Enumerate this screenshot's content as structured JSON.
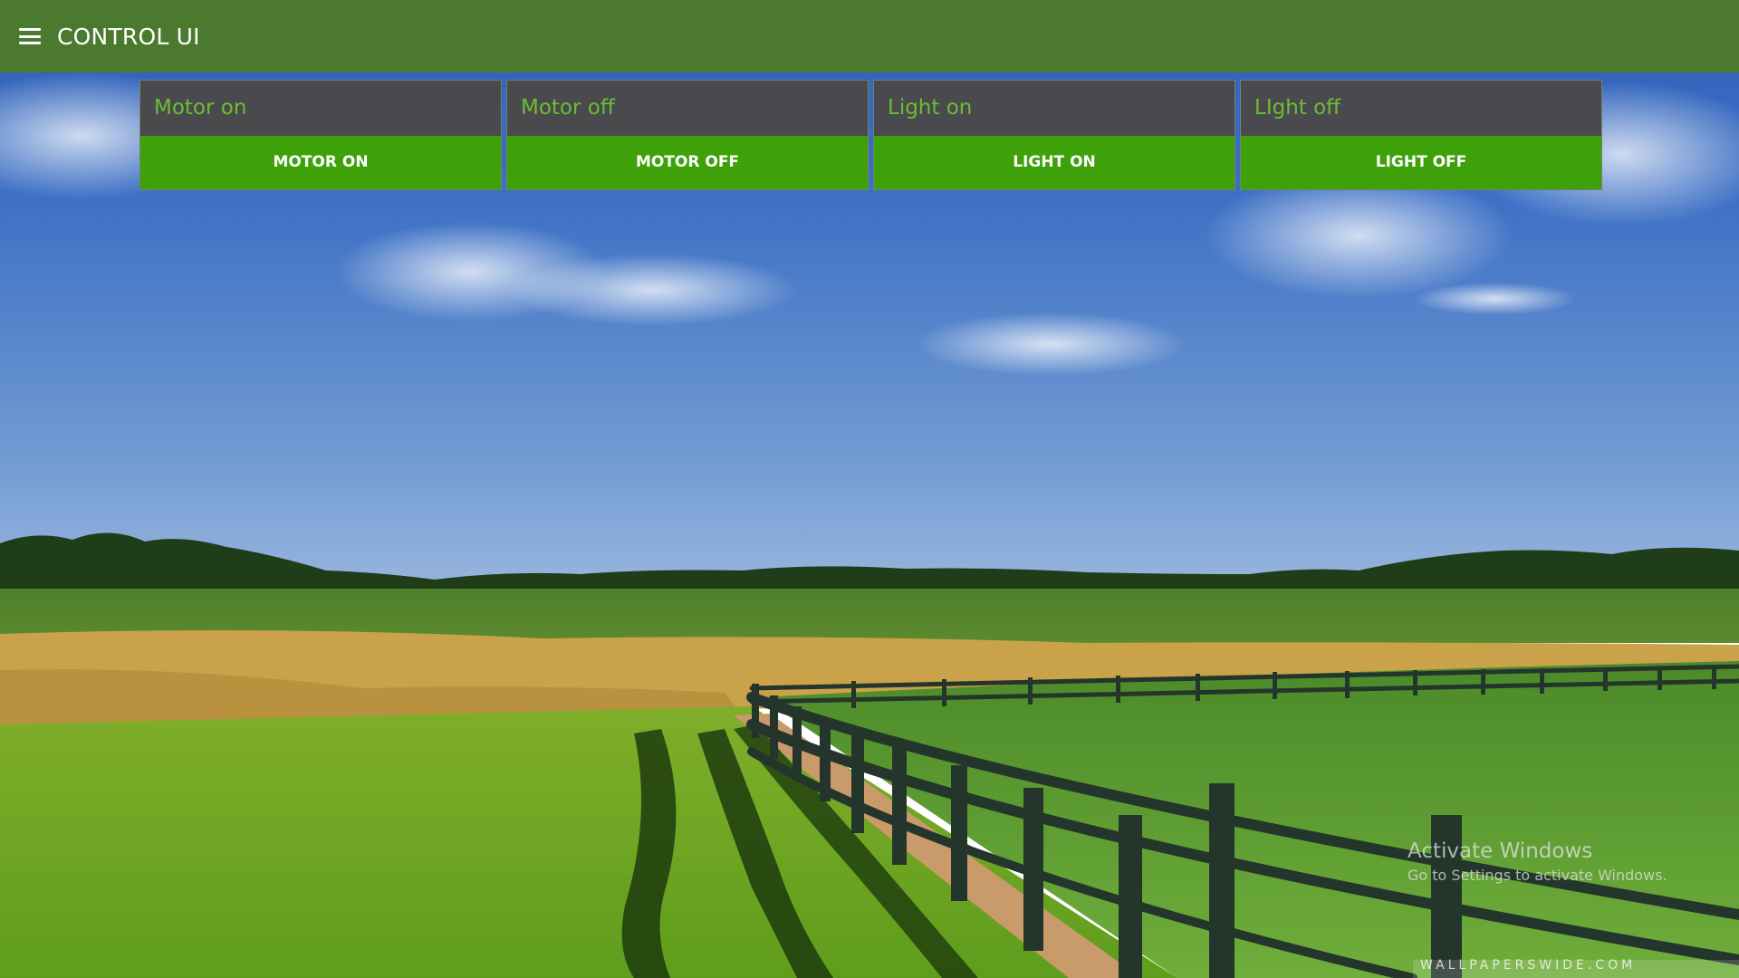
{
  "header": {
    "title": "CONTROL UI",
    "menu_icon": "hamburger-menu-icon",
    "color": "#4b7a2f"
  },
  "cards": [
    {
      "field_text": "Motor on",
      "button_label": "MOTOR ON"
    },
    {
      "field_text": "Motor off",
      "button_label": "MOTOR OFF"
    },
    {
      "field_text": "Light on",
      "button_label": "LIGHT ON"
    },
    {
      "field_text": "LIght off",
      "button_label": "LIGHT OFF"
    }
  ],
  "colors": {
    "field_bg": "#4a4a4e",
    "field_text": "#6bbd33",
    "button_bg": "#3fa10a"
  },
  "watermark": {
    "title": "Activate Windows",
    "subtitle": "Go to Settings to activate Windows.",
    "site": "WALLPAPERSWIDE.COM"
  }
}
